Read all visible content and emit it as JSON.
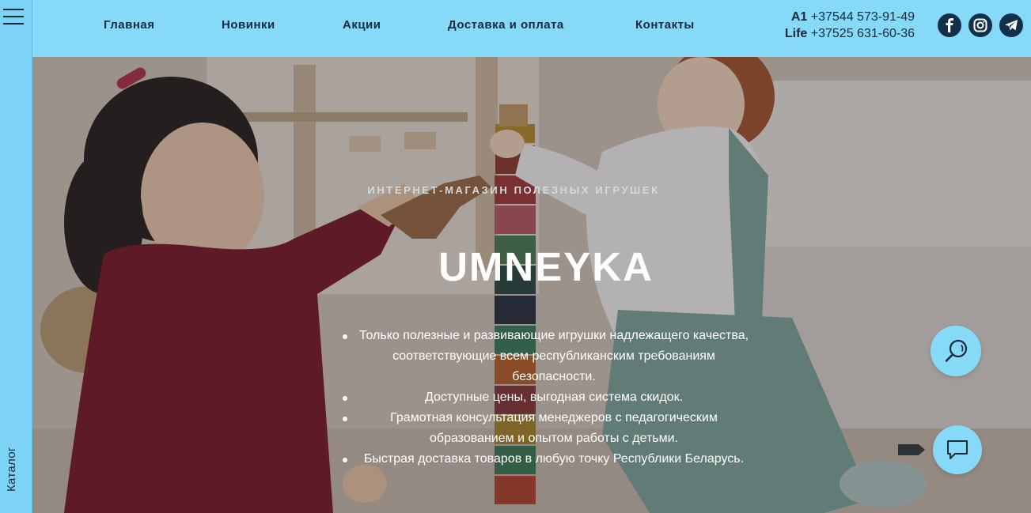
{
  "sidebar": {
    "menu_icon": "hamburger-icon",
    "catalog_label": "Каталог"
  },
  "nav": {
    "items": [
      {
        "label": "Главная"
      },
      {
        "label": "Новинки"
      },
      {
        "label": "Акции"
      },
      {
        "label": "Доставка и оплата"
      },
      {
        "label": "Контакты"
      }
    ]
  },
  "contacts": {
    "phones": [
      {
        "operator": "A1",
        "number": "+37544 573-91-49"
      },
      {
        "operator": "Life",
        "number": "+37525 631-60-36"
      }
    ]
  },
  "socials": [
    {
      "icon": "facebook-icon"
    },
    {
      "icon": "instagram-icon"
    },
    {
      "icon": "telegram-icon"
    }
  ],
  "hero": {
    "eyebrow": "ИНТЕРНЕТ-МАГАЗИН ПОЛЕЗНЫХ ИГРУШЕК",
    "title": "UMNEYKA",
    "features": [
      "Только полезные и развивающие игрушки надлежащего качества, соответствующие всем республиканским требованиям безопасности.",
      "Доступные цены, выгодная система скидок.",
      "Грамотная консультация менеджеров с педагогическим образованием и опытом работы с детьми.",
      "Быстрая доставка товаров в любую точку Республики Беларусь."
    ]
  },
  "floating": {
    "search_icon": "search-icon",
    "chat_icon": "chat-icon"
  },
  "colors": {
    "header_bg": "#87d9f8",
    "sidebar_bg": "#7dd3f5",
    "nav_text": "#142a3e",
    "social_bg": "#12304a"
  }
}
